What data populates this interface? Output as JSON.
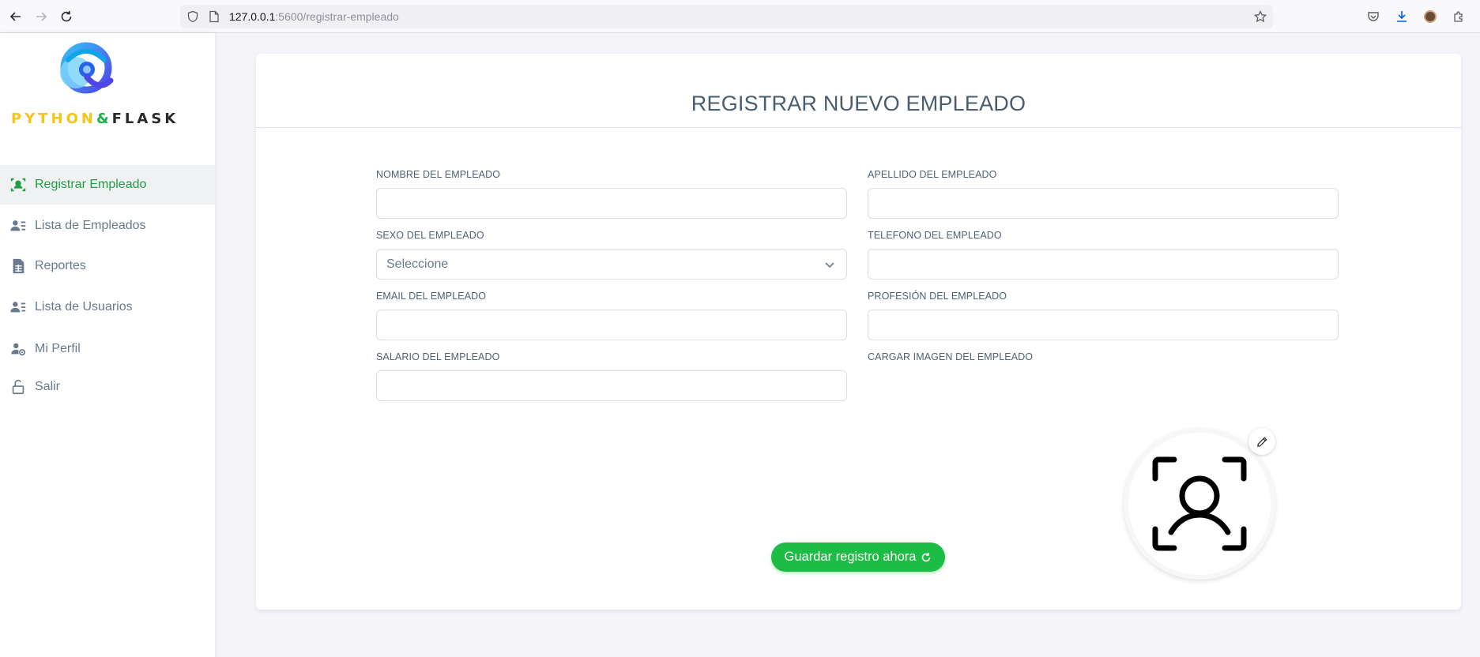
{
  "browser": {
    "url_host": "127.0.0.1",
    "url_path": ":5600/registrar-empleado"
  },
  "sidebar": {
    "logo": {
      "python": "PYTHON",
      "amp": "&",
      "flask": "FLASK"
    },
    "items": [
      {
        "label": "Registrar Empleado",
        "icon": "user-scan-icon",
        "active": true
      },
      {
        "label": "Lista de Empleados",
        "icon": "user-list-icon",
        "active": false
      },
      {
        "label": "Reportes",
        "icon": "spreadsheet-icon",
        "active": false
      },
      {
        "label": "Lista de Usuarios",
        "icon": "user-list-icon",
        "active": false
      },
      {
        "label": "Mi Perfil",
        "icon": "user-settings-icon",
        "active": false
      },
      {
        "label": "Salir",
        "icon": "unlock-icon",
        "active": false
      }
    ]
  },
  "form": {
    "title": "REGISTRAR NUEVO EMPLEADO",
    "fields": {
      "nombre": {
        "label": "NOMBRE DEL EMPLEADO",
        "value": ""
      },
      "apellido": {
        "label": "APELLIDO DEL EMPLEADO",
        "value": ""
      },
      "sexo": {
        "label": "SEXO DEL EMPLEADO",
        "value": "Seleccione"
      },
      "telefono": {
        "label": "TELEFONO DEL EMPLEADO",
        "value": ""
      },
      "email": {
        "label": "EMAIL DEL EMPLEADO",
        "value": ""
      },
      "profesion": {
        "label": "PROFESIÓN DEL EMPLEADO",
        "value": ""
      },
      "salario": {
        "label": "SALARIO DEL EMPLEADO",
        "value": ""
      },
      "imagen": {
        "label": "CARGAR IMAGEN DEL EMPLEADO"
      }
    },
    "submit_label": "Guardar registro ahora"
  },
  "colors": {
    "accent_green": "#1cbc45",
    "active_menu_text": "#1e9f45",
    "logo_yellow": "#f5c518",
    "logo_blue": "#3b82f6"
  }
}
